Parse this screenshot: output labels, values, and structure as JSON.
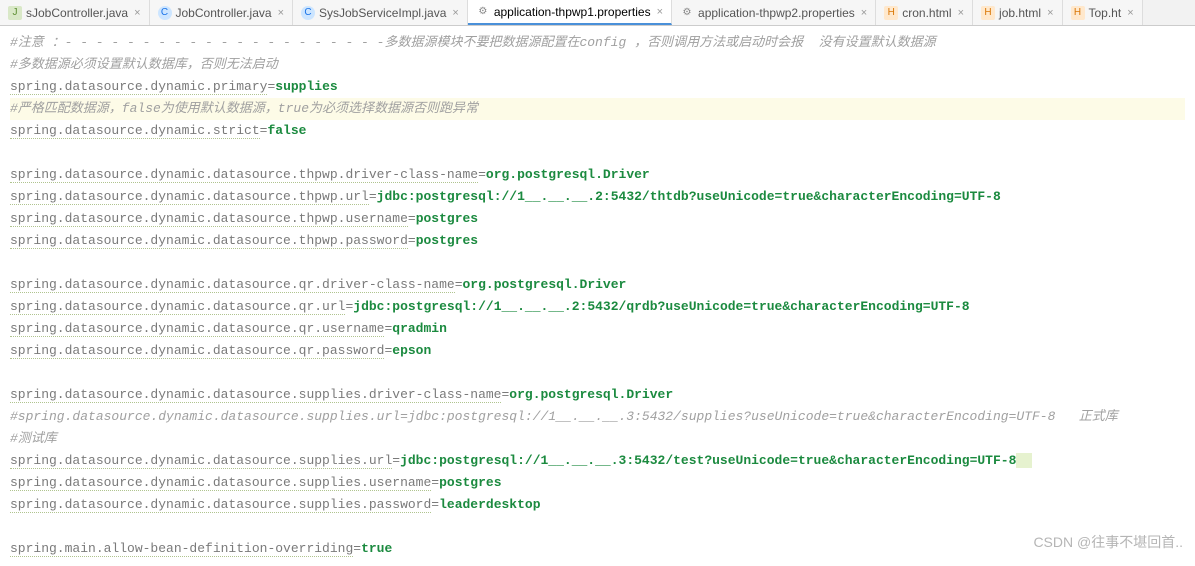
{
  "tabs": [
    {
      "label": "sJobController.java",
      "iconClass": "icon-java",
      "iconText": "J"
    },
    {
      "label": "JobController.java",
      "iconClass": "icon-class",
      "iconText": "C"
    },
    {
      "label": "SysJobServiceImpl.java",
      "iconClass": "icon-class",
      "iconText": "C"
    },
    {
      "label": "application-thpwp1.properties",
      "iconClass": "icon-props",
      "iconText": "⚙",
      "active": true
    },
    {
      "label": "application-thpwp2.properties",
      "iconClass": "icon-props",
      "iconText": "⚙"
    },
    {
      "label": "cron.html",
      "iconClass": "icon-html",
      "iconText": "H"
    },
    {
      "label": "job.html",
      "iconClass": "icon-html",
      "iconText": "H"
    },
    {
      "label": "Top.ht",
      "iconClass": "icon-html",
      "iconText": "H"
    }
  ],
  "lines": {
    "c1": "#注意 ：- - - - - - - - - - - - - - - - - - - - -多数据源模块不要把数据源配置在config ，否则调用方法或启动时会报  没有设置默认数据源",
    "c2": "#多数据源必须设置默认数据库，否则无法启动",
    "k_primary": "spring.datasource.dynamic.primary",
    "v_primary": "supplies",
    "c3": "#严格匹配数据源，false为使用默认数据源，true为必须选择数据源否则跑异常",
    "k_strict": "spring.datasource.dynamic.strict",
    "v_strict": "false",
    "k_thp_driver": "spring.datasource.dynamic.datasource.thpwp.driver-class-name",
    "v_thp_driver": "org.postgresql.Driver",
    "k_thp_url": "spring.datasource.dynamic.datasource.thpwp.url",
    "v_thp_url": "jdbc:postgresql://1__.__.__.2:5432/thtdb?useUnicode=true&characterEncoding=UTF-8",
    "k_thp_user": "spring.datasource.dynamic.datasource.thpwp.username",
    "v_thp_user": "postgres",
    "k_thp_pass": "spring.datasource.dynamic.datasource.thpwp.password",
    "v_thp_pass": "postgres",
    "k_qr_driver": "spring.datasource.dynamic.datasource.qr.driver-class-name",
    "v_qr_driver": "org.postgresql.Driver",
    "k_qr_url": "spring.datasource.dynamic.datasource.qr.url",
    "v_qr_url": "jdbc:postgresql://1__.__.__.2:5432/qrdb?useUnicode=true&characterEncoding=UTF-8",
    "k_qr_user": "spring.datasource.dynamic.datasource.qr.username",
    "v_qr_user": "qradmin",
    "k_qr_pass": "spring.datasource.dynamic.datasource.qr.password",
    "v_qr_pass": "epson",
    "k_sup_driver": "spring.datasource.dynamic.datasource.supplies.driver-class-name",
    "v_sup_driver": "org.postgresql.Driver",
    "c4a": "#spring.datasource.dynamic.datasource.supplies.url=jdbc:postgresql://1__.__.__.3:5432/supplies?useUnicode=true&characterEncoding=UTF-8",
    "c4b": "   正式库",
    "c5": "#测试库",
    "k_sup_url": "spring.datasource.dynamic.datasource.supplies.url",
    "v_sup_url": "jdbc:postgresql://1__.__.__.3:5432/test?useUnicode=true&characterEncoding=UTF-8",
    "k_sup_user": "spring.datasource.dynamic.datasource.supplies.username",
    "v_sup_user": "postgres",
    "k_sup_pass": "spring.datasource.dynamic.datasource.supplies.password",
    "v_sup_pass": "leaderdesktop",
    "k_main": "spring.main.allow-bean-definition-overriding",
    "v_main": "true"
  },
  "watermark": "CSDN @往事不堪回首.."
}
